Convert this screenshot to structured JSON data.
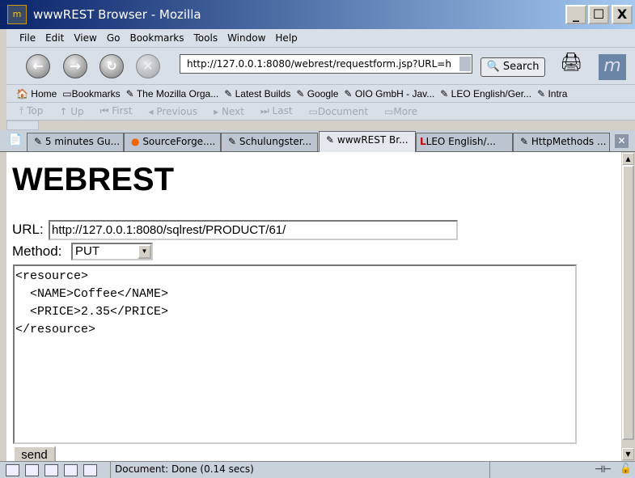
{
  "window": {
    "title": "wwwREST Browser - Mozilla",
    "minimize": "_",
    "maximize": "☐",
    "close": "X"
  },
  "menu": [
    "File",
    "Edit",
    "View",
    "Go",
    "Bookmarks",
    "Tools",
    "Window",
    "Help"
  ],
  "nav": {
    "back": "←",
    "forward": "→",
    "reload": "↻",
    "stop": "✕",
    "url": "http://127.0.0.1:8080/webrest/requestform.jsp?URL=h",
    "search": "Search"
  },
  "bookmarks": [
    "Home",
    "Bookmarks",
    "The Mozilla Orga...",
    "Latest Builds",
    "Google",
    "OIO GmbH - Jav...",
    "LEO English/Ger...",
    "Intra"
  ],
  "site_nav": [
    "Top",
    "Up",
    "First",
    "Previous",
    "Next",
    "Last",
    "Document",
    "More"
  ],
  "tabs": [
    {
      "label": "5 minutes Gu..."
    },
    {
      "label": "SourceForge...."
    },
    {
      "label": "Schulungster..."
    },
    {
      "label": "wwwREST Br...",
      "active": true
    },
    {
      "label": "LEO English/..."
    },
    {
      "label": "HttpMethods ..."
    }
  ],
  "page": {
    "heading": "WEBREST",
    "url_label": "URL:",
    "url_value": "http://127.0.0.1:8080/sqlrest/PRODUCT/61/",
    "method_label": "Method:",
    "method_value": "PUT",
    "body": "<resource>\n  <NAME>Coffee</NAME>\n  <PRICE>2.35</PRICE>\n</resource>",
    "send": "send"
  },
  "status": {
    "text": "Document: Done (0.14 secs)"
  }
}
